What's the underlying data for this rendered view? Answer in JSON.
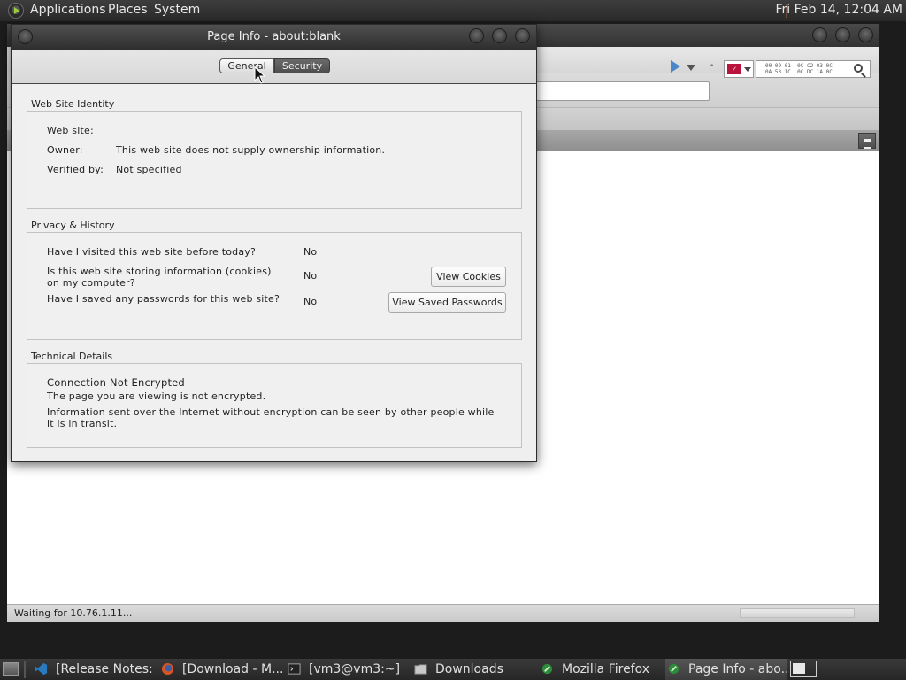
{
  "top_panel": {
    "menus": [
      "Applications",
      "Places",
      "System"
    ],
    "clock": "Fri Feb 14, 12:04 AM"
  },
  "browser": {
    "status": "Waiting for 10.76.1.11...",
    "search_hex": "00 09 01  0C C2 03 0C\n0A 53 1C  0C DC 1A 0C"
  },
  "dialog": {
    "title": "Page Info - about:blank",
    "tabs": {
      "general": "General",
      "security": "Security"
    },
    "identity": {
      "heading": "Web Site Identity",
      "website_label": "Web site:",
      "owner_label": "Owner:",
      "owner_value": "This web site does not supply ownership information.",
      "verified_label": "Verified by:",
      "verified_value": "Not specified"
    },
    "privacy": {
      "heading": "Privacy & History",
      "q1": "Have I visited this web site before today?",
      "a1": "No",
      "q2": "Is this web site storing information (cookies) on my computer?",
      "a2": "No",
      "q3": "Have I saved any passwords for this web site?",
      "a3": "No",
      "view_cookies": "View Cookies",
      "view_passwords": "View Saved Passwords"
    },
    "technical": {
      "heading": "Technical Details",
      "line1": "Connection Not Encrypted",
      "line2": "The page you are viewing is not encrypted.",
      "line3": "Information sent over the Internet without encryption can be seen by other people while it is in transit."
    }
  },
  "taskbar": {
    "items": [
      {
        "label": "[Release Notes: ...",
        "icon": "vscode-icon"
      },
      {
        "label": "[Download - M...",
        "icon": "firefox-icon"
      },
      {
        "label": "[vm3@vm3:~]",
        "icon": "terminal-icon"
      },
      {
        "label": "Downloads",
        "icon": "folder-icon"
      },
      {
        "label": "Mozilla Firefox",
        "icon": "firefox-green-icon"
      },
      {
        "label": "Page Info - abo...",
        "icon": "page-info-icon"
      }
    ]
  }
}
